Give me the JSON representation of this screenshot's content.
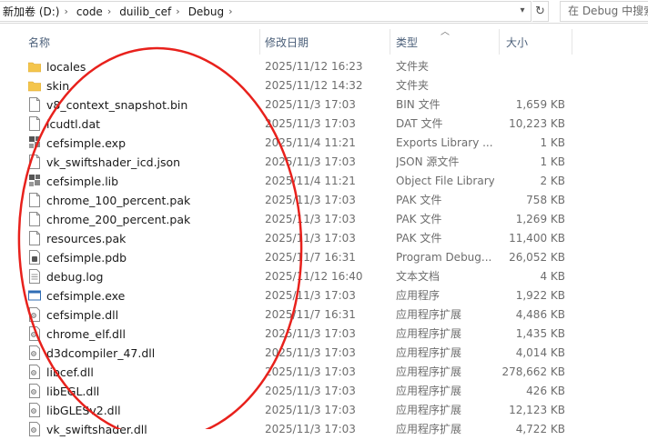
{
  "addressbar": {
    "crumbs": [
      "新加卷 (D:)",
      "code",
      "duilib_cef",
      "Debug"
    ],
    "dropdown_icon": "chevron-down-icon",
    "refresh_icon": "refresh-icon",
    "search_placeholder": "在 Debug 中搜索"
  },
  "columns": {
    "name": "名称",
    "date": "修改日期",
    "type": "类型",
    "size": "大小",
    "sorted_by": "type"
  },
  "files": [
    {
      "name": "locales",
      "date": "2025/11/12 16:23",
      "type": "文件夹",
      "size": "",
      "icon": "folder-icon"
    },
    {
      "name": "skin",
      "date": "2025/11/12 14:32",
      "type": "文件夹",
      "size": "",
      "icon": "folder-icon"
    },
    {
      "name": "v8_context_snapshot.bin",
      "date": "2025/11/3 17:03",
      "type": "BIN 文件",
      "size": "1,659 KB",
      "icon": "file-icon"
    },
    {
      "name": "icudtl.dat",
      "date": "2025/11/3 17:03",
      "type": "DAT 文件",
      "size": "10,223 KB",
      "icon": "file-icon"
    },
    {
      "name": "cefsimple.exp",
      "date": "2025/11/4 11:21",
      "type": "Exports Library ...",
      "size": "1 KB",
      "icon": "exp-file-icon"
    },
    {
      "name": "vk_swiftshader_icd.json",
      "date": "2025/11/3 17:03",
      "type": "JSON 源文件",
      "size": "1 KB",
      "icon": "file-icon"
    },
    {
      "name": "cefsimple.lib",
      "date": "2025/11/4 11:21",
      "type": "Object File Library",
      "size": "2 KB",
      "icon": "lib-file-icon"
    },
    {
      "name": "chrome_100_percent.pak",
      "date": "2025/11/3 17:03",
      "type": "PAK 文件",
      "size": "758 KB",
      "icon": "file-icon"
    },
    {
      "name": "chrome_200_percent.pak",
      "date": "2025/11/3 17:03",
      "type": "PAK 文件",
      "size": "1,269 KB",
      "icon": "file-icon"
    },
    {
      "name": "resources.pak",
      "date": "2025/11/3 17:03",
      "type": "PAK 文件",
      "size": "11,400 KB",
      "icon": "file-icon"
    },
    {
      "name": "cefsimple.pdb",
      "date": "2025/11/7 16:31",
      "type": "Program Debug...",
      "size": "26,052 KB",
      "icon": "pdb-file-icon"
    },
    {
      "name": "debug.log",
      "date": "2025/11/12 16:40",
      "type": "文本文档",
      "size": "4 KB",
      "icon": "text-file-icon"
    },
    {
      "name": "cefsimple.exe",
      "date": "2025/11/3 17:03",
      "type": "应用程序",
      "size": "1,922 KB",
      "icon": "exe-icon"
    },
    {
      "name": "cefsimple.dll",
      "date": "2025/11/7 16:31",
      "type": "应用程序扩展",
      "size": "4,486 KB",
      "icon": "dll-icon"
    },
    {
      "name": "chrome_elf.dll",
      "date": "2025/11/3 17:03",
      "type": "应用程序扩展",
      "size": "1,435 KB",
      "icon": "dll-icon"
    },
    {
      "name": "d3dcompiler_47.dll",
      "date": "2025/11/3 17:03",
      "type": "应用程序扩展",
      "size": "4,014 KB",
      "icon": "dll-icon"
    },
    {
      "name": "libcef.dll",
      "date": "2025/11/3 17:03",
      "type": "应用程序扩展",
      "size": "278,662 KB",
      "icon": "dll-icon"
    },
    {
      "name": "libEGL.dll",
      "date": "2025/11/3 17:03",
      "type": "应用程序扩展",
      "size": "426 KB",
      "icon": "dll-icon"
    },
    {
      "name": "libGLESv2.dll",
      "date": "2025/11/3 17:03",
      "type": "应用程序扩展",
      "size": "12,123 KB",
      "icon": "dll-icon"
    },
    {
      "name": "vk_swiftshader.dll",
      "date": "2025/11/3 17:03",
      "type": "应用程序扩展",
      "size": "4,722 KB",
      "icon": "dll-icon"
    }
  ],
  "colors": {
    "folder": "#f4c54c",
    "header_text": "#4c607a",
    "annotation_ellipse": "#e8211c",
    "exe_blue": "#2f6db5"
  }
}
